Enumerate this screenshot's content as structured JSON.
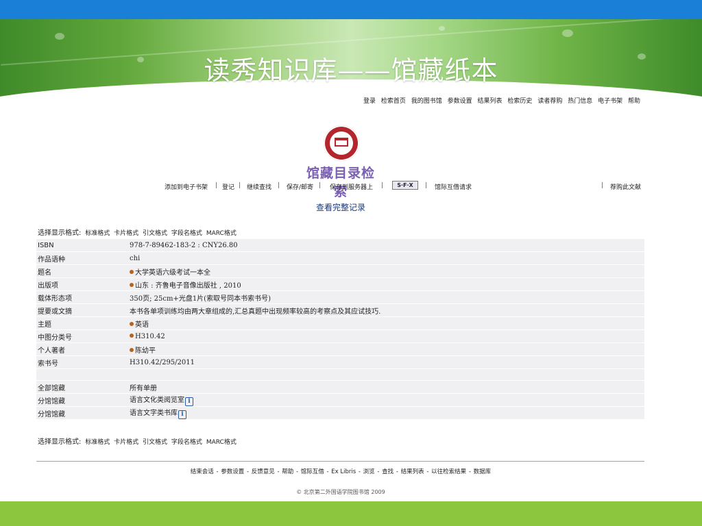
{
  "banner": {
    "title": "读秀知识库——馆藏纸本"
  },
  "top_links": [
    "登录",
    "检索首页",
    "我的图书馆",
    "参数设置",
    "结果列表",
    "检索历史",
    "读者荐购",
    "热门信息",
    "电子书架",
    "帮助"
  ],
  "logo": {
    "text": "馆藏目录检索"
  },
  "actions": {
    "add_shelf": "添加到电子书架",
    "register": "登记",
    "continue_search": "继续查找",
    "save_mail": "保存/邮寄",
    "save_server": "保存到服务器上",
    "sfx": "S·F·X",
    "ill_request": "馆际互借请求",
    "recommend": "荐购此文献"
  },
  "view_full": "查看完整记录",
  "format_bar": {
    "label": "选择显示格式:",
    "formats": [
      "标准格式",
      "卡片格式",
      "引文格式",
      "字段名格式",
      "MARC格式"
    ]
  },
  "record": [
    {
      "key": "ISBN",
      "value": "978-7-89462-183-2 : CNY26.80"
    },
    {
      "key": "作品语种",
      "value": "chi"
    },
    {
      "key": "题名",
      "value": "大学英语六级考试一本全"
    },
    {
      "key": "出版项",
      "value": "山东 : 齐鲁电子音像出版社 , 2010"
    },
    {
      "key": "载体形态项",
      "value": "350页; 25cm+光盘1片(索取号同本书索书号)"
    },
    {
      "key": "提要或文摘",
      "value": "本书各单项训练均由两大章组成的,汇总真题中出现频率较高的考察点及其应试技巧."
    },
    {
      "key": "主题",
      "value": "英语"
    },
    {
      "key": "中图分类号",
      "value": "H310.42"
    },
    {
      "key": "个人著者",
      "value": "陈幼平"
    },
    {
      "key": "索书号",
      "value": "H310.42/295/2011"
    },
    {
      "key": "全部馆藏",
      "value": "所有单册"
    },
    {
      "key": "分馆馆藏",
      "value": "语言文化类阅览室"
    },
    {
      "key": "分馆馆藏",
      "value": "语言文字类书库"
    }
  ],
  "footer": {
    "links": [
      "结束会话",
      "参数设置",
      "反馈意见",
      "帮助",
      "馆际互借",
      "Ex Libris",
      "浏览",
      "查找",
      "结果列表",
      "以往检索结果",
      "数据库"
    ],
    "copyright": "© 北京第二外国语学院图书馆  2009"
  }
}
